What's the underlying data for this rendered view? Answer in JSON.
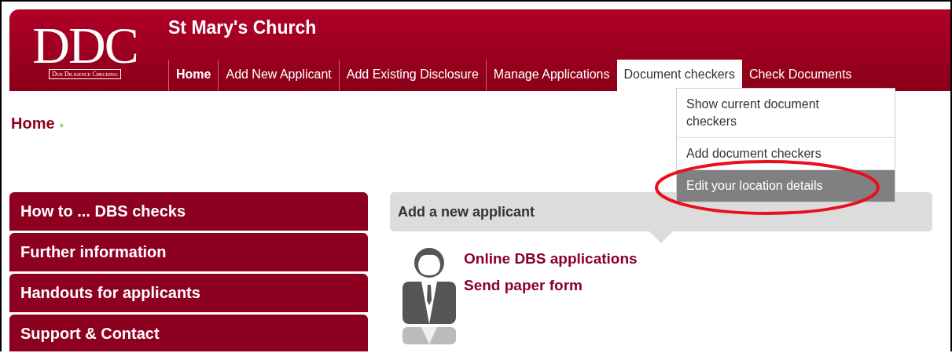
{
  "logo": {
    "mark": "DDC",
    "tagline": "Due Diligence Checking"
  },
  "site_title": "St Mary's Church",
  "nav": [
    {
      "label": "Home",
      "selected": false,
      "bold": true
    },
    {
      "label": "Add New Applicant",
      "selected": false,
      "bold": false
    },
    {
      "label": "Add Existing Disclosure",
      "selected": false,
      "bold": false
    },
    {
      "label": "Manage Applications",
      "selected": false,
      "bold": false
    },
    {
      "label": "Document checkers",
      "selected": true,
      "bold": false
    },
    {
      "label": "Check Documents",
      "selected": false,
      "bold": false
    }
  ],
  "dropdown": {
    "items": [
      {
        "label": "Show current document checkers",
        "selected": false
      },
      {
        "label": "Add document checkers",
        "selected": false
      },
      {
        "label": "Edit your location details",
        "selected": true
      }
    ]
  },
  "breadcrumb": "Home",
  "sidebar": {
    "items": [
      "How to ... DBS checks",
      "Further information",
      "Handouts for applicants",
      "Support & Contact"
    ]
  },
  "panel": {
    "title": "Add a new applicant",
    "links": [
      "Online DBS applications",
      "Send paper form"
    ]
  }
}
